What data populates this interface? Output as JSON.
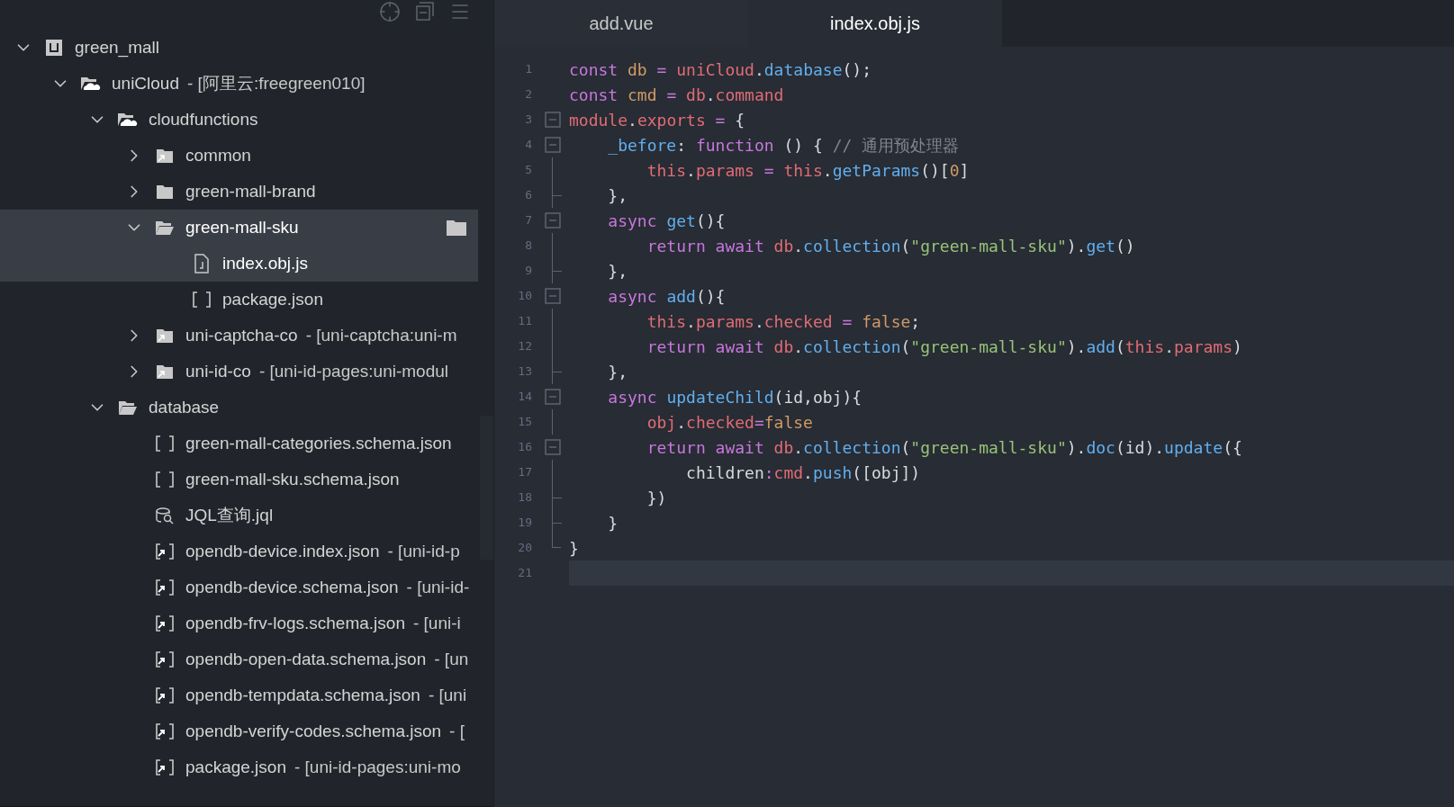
{
  "sidebar": {
    "tree": [
      {
        "name": "green_mall",
        "kind": "project",
        "expanded": true,
        "selected": false,
        "children": [
          {
            "name": "uniCloud",
            "suffix": "- [阿里云:freegreen010]",
            "kind": "cloud-folder",
            "expanded": true,
            "selected": false,
            "children": [
              {
                "name": "cloudfunctions",
                "kind": "cloud-folder",
                "expanded": true,
                "selected": false,
                "children": [
                  {
                    "name": "common",
                    "kind": "link-folder",
                    "expanded": false,
                    "selected": false
                  },
                  {
                    "name": "green-mall-brand",
                    "kind": "folder",
                    "expanded": false,
                    "selected": false
                  },
                  {
                    "name": "green-mall-sku",
                    "kind": "open-folder",
                    "expanded": true,
                    "selected": true,
                    "children": [
                      {
                        "name": "index.obj.js",
                        "kind": "js-file",
                        "selected": true
                      },
                      {
                        "name": "package.json",
                        "kind": "json-file",
                        "selected": false
                      }
                    ]
                  },
                  {
                    "name": "uni-captcha-co",
                    "suffix": "- [uni-captcha:uni-m",
                    "kind": "link-folder",
                    "expanded": false,
                    "selected": false
                  },
                  {
                    "name": "uni-id-co",
                    "suffix": "- [uni-id-pages:uni-modul",
                    "kind": "link-folder",
                    "expanded": false,
                    "selected": false
                  }
                ]
              },
              {
                "name": "database",
                "kind": "open-folder",
                "expanded": true,
                "selected": false,
                "children": [
                  {
                    "name": "green-mall-categories.schema.json",
                    "kind": "json-file",
                    "selected": false
                  },
                  {
                    "name": "green-mall-sku.schema.json",
                    "kind": "json-file",
                    "selected": false
                  },
                  {
                    "name": "JQL查询.jql",
                    "kind": "jql-file",
                    "selected": false
                  },
                  {
                    "name": "opendb-device.index.json",
                    "suffix": "- [uni-id-p",
                    "kind": "link-json",
                    "selected": false
                  },
                  {
                    "name": "opendb-device.schema.json",
                    "suffix": "- [uni-id-",
                    "kind": "link-json",
                    "selected": false
                  },
                  {
                    "name": "opendb-frv-logs.schema.json",
                    "suffix": "- [uni-i",
                    "kind": "link-json",
                    "selected": false
                  },
                  {
                    "name": "opendb-open-data.schema.json",
                    "suffix": "- [un",
                    "kind": "link-json",
                    "selected": false
                  },
                  {
                    "name": "opendb-tempdata.schema.json",
                    "suffix": "- [uni",
                    "kind": "link-json",
                    "selected": false
                  },
                  {
                    "name": "opendb-verify-codes.schema.json",
                    "suffix": "- [",
                    "kind": "link-json",
                    "selected": false
                  },
                  {
                    "name": "package.json",
                    "suffix": "- [uni-id-pages:uni-mo",
                    "kind": "link-json",
                    "selected": false
                  }
                ]
              }
            ]
          }
        ]
      }
    ]
  },
  "tabs": [
    {
      "label": "add.vue",
      "selected": false
    },
    {
      "label": "index.obj.js",
      "selected": true
    }
  ],
  "editor": {
    "lines": [
      {
        "number": "1",
        "kind": "plain",
        "current": false,
        "tokens": [
          {
            "kind": "keyword",
            "text": "const"
          },
          {
            "kind": "variable",
            "text": " db"
          },
          {
            "kind": "operator",
            "text": " ="
          },
          {
            "kind": "object",
            "text": " uniCloud"
          },
          {
            "kind": "punct",
            "text": "."
          },
          {
            "kind": "function",
            "text": "database"
          },
          {
            "kind": "punct",
            "text": "();"
          }
        ]
      },
      {
        "number": "2",
        "kind": "plain",
        "current": false,
        "tokens": [
          {
            "kind": "keyword",
            "text": "const"
          },
          {
            "kind": "variable",
            "text": " cmd"
          },
          {
            "kind": "operator",
            "text": " ="
          },
          {
            "kind": "object",
            "text": " db"
          },
          {
            "kind": "punct",
            "text": "."
          },
          {
            "kind": "object",
            "text": "command"
          }
        ]
      },
      {
        "number": "3",
        "kind": "fold",
        "current": false,
        "tokens": [
          {
            "kind": "object",
            "text": "module"
          },
          {
            "kind": "punct",
            "text": "."
          },
          {
            "kind": "object",
            "text": "exports"
          },
          {
            "kind": "operator",
            "text": " ="
          },
          {
            "kind": "punct",
            "text": " {"
          }
        ]
      },
      {
        "number": "4",
        "kind": "fold",
        "current": false,
        "tokens": [
          {
            "kind": "function",
            "text": "    _before"
          },
          {
            "kind": "punct",
            "text": ":"
          },
          {
            "kind": "keyword",
            "text": " function"
          },
          {
            "kind": "punct",
            "text": " () {"
          },
          {
            "kind": "comment",
            "text": " // 通用预处理器"
          }
        ]
      },
      {
        "number": "5",
        "kind": "bar",
        "current": false,
        "tokens": [
          {
            "kind": "object",
            "text": "        this"
          },
          {
            "kind": "punct",
            "text": "."
          },
          {
            "kind": "object",
            "text": "params"
          },
          {
            "kind": "operator",
            "text": " ="
          },
          {
            "kind": "object",
            "text": " this"
          },
          {
            "kind": "punct",
            "text": "."
          },
          {
            "kind": "function",
            "text": "getParams"
          },
          {
            "kind": "punct",
            "text": "()["
          },
          {
            "kind": "number",
            "text": "0"
          },
          {
            "kind": "punct",
            "text": "]"
          }
        ]
      },
      {
        "number": "6",
        "kind": "end",
        "current": false,
        "tokens": [
          {
            "kind": "punct",
            "text": "    },"
          }
        ]
      },
      {
        "number": "7",
        "kind": "fold",
        "current": false,
        "tokens": [
          {
            "kind": "keyword",
            "text": "    async"
          },
          {
            "kind": "function",
            "text": " get"
          },
          {
            "kind": "punct",
            "text": "(){"
          }
        ]
      },
      {
        "number": "8",
        "kind": "bar",
        "current": false,
        "tokens": [
          {
            "kind": "keyword",
            "text": "        return await"
          },
          {
            "kind": "object",
            "text": " db"
          },
          {
            "kind": "punct",
            "text": "."
          },
          {
            "kind": "function",
            "text": "collection"
          },
          {
            "kind": "punct",
            "text": "("
          },
          {
            "kind": "string",
            "text": "\"green-mall-sku\""
          },
          {
            "kind": "punct",
            "text": ")."
          },
          {
            "kind": "function",
            "text": "get"
          },
          {
            "kind": "punct",
            "text": "()"
          }
        ]
      },
      {
        "number": "9",
        "kind": "end",
        "current": false,
        "tokens": [
          {
            "kind": "punct",
            "text": "    },"
          }
        ]
      },
      {
        "number": "10",
        "kind": "fold",
        "current": false,
        "tokens": [
          {
            "kind": "keyword",
            "text": "    async"
          },
          {
            "kind": "function",
            "text": " add"
          },
          {
            "kind": "punct",
            "text": "(){"
          }
        ]
      },
      {
        "number": "11",
        "kind": "bar",
        "current": false,
        "tokens": [
          {
            "kind": "object",
            "text": "        this"
          },
          {
            "kind": "punct",
            "text": "."
          },
          {
            "kind": "object",
            "text": "params"
          },
          {
            "kind": "punct",
            "text": "."
          },
          {
            "kind": "object",
            "text": "checked"
          },
          {
            "kind": "operator",
            "text": " ="
          },
          {
            "kind": "variable",
            "text": " false"
          },
          {
            "kind": "punct",
            "text": ";"
          }
        ]
      },
      {
        "number": "12",
        "kind": "bar",
        "current": false,
        "tokens": [
          {
            "kind": "keyword",
            "text": "        return await"
          },
          {
            "kind": "object",
            "text": " db"
          },
          {
            "kind": "punct",
            "text": "."
          },
          {
            "kind": "function",
            "text": "collection"
          },
          {
            "kind": "punct",
            "text": "("
          },
          {
            "kind": "string",
            "text": "\"green-mall-sku\""
          },
          {
            "kind": "punct",
            "text": ")."
          },
          {
            "kind": "function",
            "text": "add"
          },
          {
            "kind": "punct",
            "text": "("
          },
          {
            "kind": "object",
            "text": "this"
          },
          {
            "kind": "punct",
            "text": "."
          },
          {
            "kind": "object",
            "text": "params"
          },
          {
            "kind": "punct",
            "text": ")"
          }
        ]
      },
      {
        "number": "13",
        "kind": "end",
        "current": false,
        "tokens": [
          {
            "kind": "punct",
            "text": "    },"
          }
        ]
      },
      {
        "number": "14",
        "kind": "fold",
        "current": false,
        "tokens": [
          {
            "kind": "keyword",
            "text": "    async"
          },
          {
            "kind": "function",
            "text": " updateChild"
          },
          {
            "kind": "punct",
            "text": "(id,obj){"
          }
        ]
      },
      {
        "number": "15",
        "kind": "bar",
        "current": false,
        "tokens": [
          {
            "kind": "object",
            "text": "        obj"
          },
          {
            "kind": "punct",
            "text": "."
          },
          {
            "kind": "object",
            "text": "checked"
          },
          {
            "kind": "operator",
            "text": "="
          },
          {
            "kind": "variable",
            "text": "false"
          }
        ]
      },
      {
        "number": "16",
        "kind": "fold",
        "current": false,
        "tokens": [
          {
            "kind": "keyword",
            "text": "        return await"
          },
          {
            "kind": "object",
            "text": " db"
          },
          {
            "kind": "punct",
            "text": "."
          },
          {
            "kind": "function",
            "text": "collection"
          },
          {
            "kind": "punct",
            "text": "("
          },
          {
            "kind": "string",
            "text": "\"green-mall-sku\""
          },
          {
            "kind": "punct",
            "text": ")."
          },
          {
            "kind": "function",
            "text": "doc"
          },
          {
            "kind": "punct",
            "text": "(id)."
          },
          {
            "kind": "function",
            "text": "update"
          },
          {
            "kind": "punct",
            "text": "({"
          }
        ]
      },
      {
        "number": "17",
        "kind": "bar",
        "current": false,
        "tokens": [
          {
            "kind": "punct",
            "text": "            children"
          },
          {
            "kind": "operator",
            "text": ":"
          },
          {
            "kind": "object",
            "text": "cmd"
          },
          {
            "kind": "punct",
            "text": "."
          },
          {
            "kind": "function",
            "text": "push"
          },
          {
            "kind": "punct",
            "text": "([obj])"
          }
        ]
      },
      {
        "number": "18",
        "kind": "end",
        "current": false,
        "tokens": [
          {
            "kind": "punct",
            "text": "        })"
          }
        ]
      },
      {
        "number": "19",
        "kind": "end",
        "current": false,
        "tokens": [
          {
            "kind": "punct",
            "text": "    }"
          }
        ]
      },
      {
        "number": "20",
        "kind": "corner",
        "current": false,
        "tokens": [
          {
            "kind": "punct",
            "text": "}"
          }
        ]
      },
      {
        "number": "21",
        "kind": "plain",
        "current": true
      }
    ]
  }
}
